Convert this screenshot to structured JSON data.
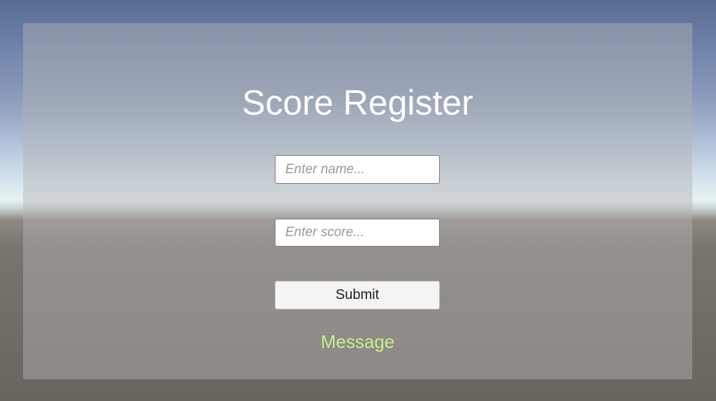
{
  "form": {
    "title": "Score Register",
    "name_placeholder": "Enter name...",
    "score_placeholder": "Enter score...",
    "submit_label": "Submit",
    "message": "Message"
  },
  "colors": {
    "title": "#ffffff",
    "message": "#c5ef8e",
    "button_bg": "#f4f4f4"
  }
}
